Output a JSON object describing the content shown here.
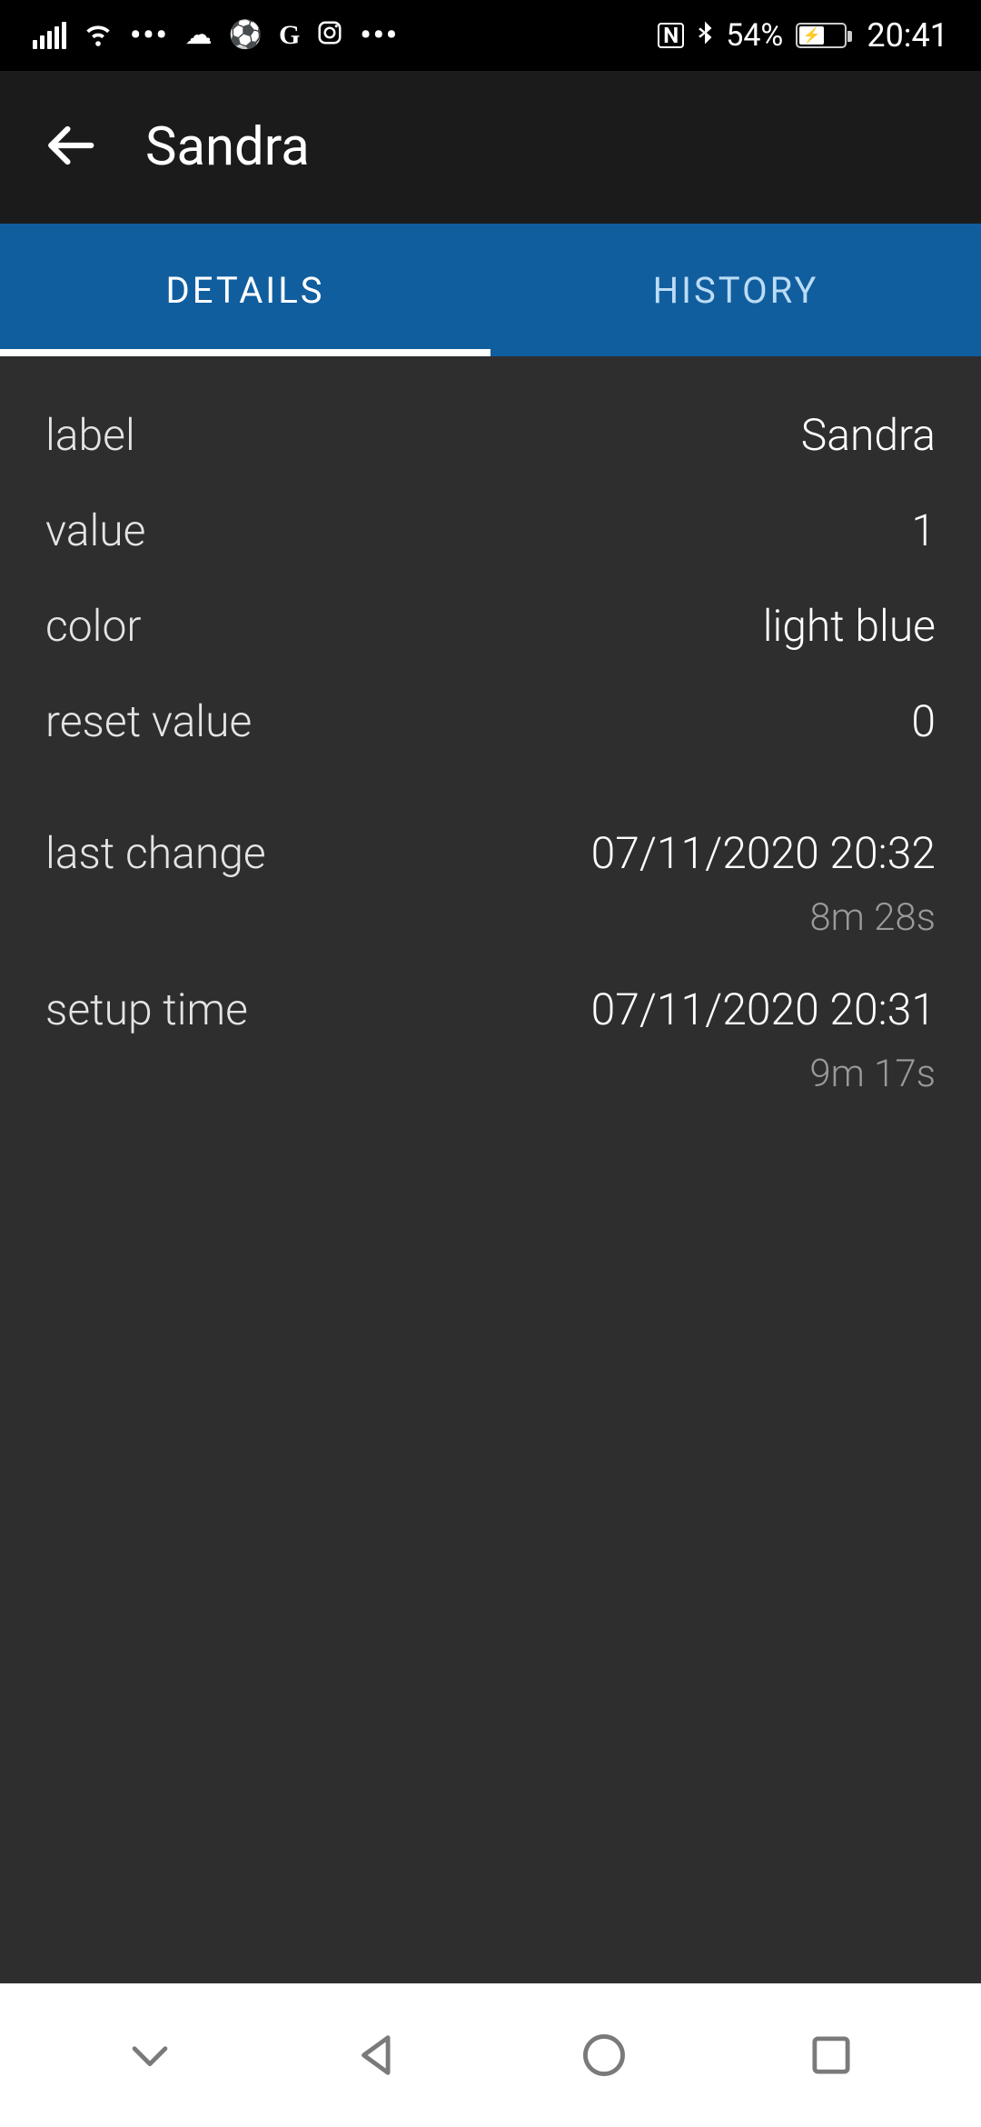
{
  "status": {
    "battery_pct": "54%",
    "time": "20:41"
  },
  "header": {
    "title": "Sandra"
  },
  "tabs": {
    "details": "DETAILS",
    "history": "HISTORY"
  },
  "details": {
    "label_key": "label",
    "label_val": "Sandra",
    "value_key": "value",
    "value_val": "1",
    "color_key": "color",
    "color_val": "light blue",
    "reset_key": "reset value",
    "reset_val": "0",
    "last_change_key": "last change",
    "last_change_val": "07/11/2020 20:32",
    "last_change_ago": "8m 28s",
    "setup_time_key": "setup time",
    "setup_time_val": "07/11/2020 20:31",
    "setup_time_ago": "9m 17s"
  }
}
